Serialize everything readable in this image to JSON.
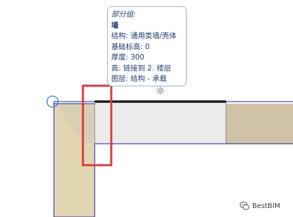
{
  "tooltip": {
    "category_label": "部分组:",
    "element_type": "墙",
    "properties": [
      "结构: 通用类墙/壳体",
      "基础标高: 0",
      "厚度: 300",
      "高: 链接到 2. 楼层",
      "图层: 结构 - 承载"
    ]
  },
  "icons": {
    "pick": "crosshair-circle-icon",
    "cursor": "sun-cursor-icon",
    "logo": "wechat-logo-icon"
  },
  "colors": {
    "wall_fill_light": "#e2d6b2",
    "wall_fill_dark": "#cfc2a5",
    "wall_highlight": "#ebebeb",
    "highlight_box": "#d93b3b",
    "outline_blue": "#1a1a9e",
    "selected_edge": "#1a1a1a"
  },
  "watermark": {
    "text": "BestBIM"
  }
}
